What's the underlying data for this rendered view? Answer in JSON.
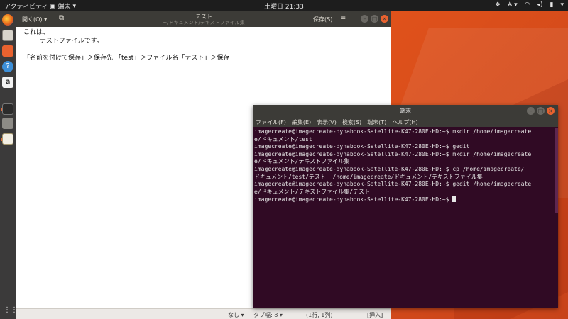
{
  "topbar": {
    "activities": "アクティビティ",
    "app_name": "端末",
    "clock": "土曜日 21:33",
    "input_method": "A"
  },
  "gedit": {
    "open_label": "開く(O)",
    "title": "テスト",
    "subtitle": "~/ドキュメント/テキストファイル集",
    "save_label": "保存(S)",
    "lines": [
      "これは、",
      "        テストファイルです。",
      "",
      "「名前を付けて保存」＞保存先:「test」＞ファイル名「テスト」＞保存"
    ],
    "status": {
      "syntax": "なし",
      "tab_width": "タブ幅: 8",
      "position": "(1行, 1列)",
      "mode": "[挿入]"
    }
  },
  "terminal": {
    "title": "端末",
    "menu": [
      "ファイル(F)",
      "編集(E)",
      "表示(V)",
      "検索(S)",
      "端末(T)",
      "ヘルプ(H)"
    ],
    "lines": [
      "imagecreate@imagecreate-dynabook-Satellite-K47-280E-HD:~$ mkdir /home/imagecreate",
      "e/ドキュメント/test",
      "imagecreate@imagecreate-dynabook-Satellite-K47-280E-HD:~$ gedit",
      "imagecreate@imagecreate-dynabook-Satellite-K47-280E-HD:~$ mkdir /home/imagecreate",
      "e/ドキュメント/テキストファイル集",
      "imagecreate@imagecreate-dynabook-Satellite-K47-280E-HD:~$ cp /home/imagecreate/",
      "ドキュメント/test/テスト  /home/imagecreate/ドキュメント/テキストファイル集",
      "imagecreate@imagecreate-dynabook-Satellite-K47-280E-HD:~$ gedit /home/imagecreate",
      "e/ドキュメント/テキストファイル集/テスト"
    ],
    "prompt": "imagecreate@imagecreate-dynabook-Satellite-K47-280E-HD:~$ "
  },
  "dock_icons": [
    "firefox-icon",
    "files-icon",
    "software-icon",
    "help-icon",
    "amazon-icon",
    "terminal-icon",
    "camera-icon",
    "text-editor-icon"
  ],
  "colors": {
    "terminal_bg": "#300a24",
    "accent": "#e9622f",
    "header": "#3c3b37"
  }
}
